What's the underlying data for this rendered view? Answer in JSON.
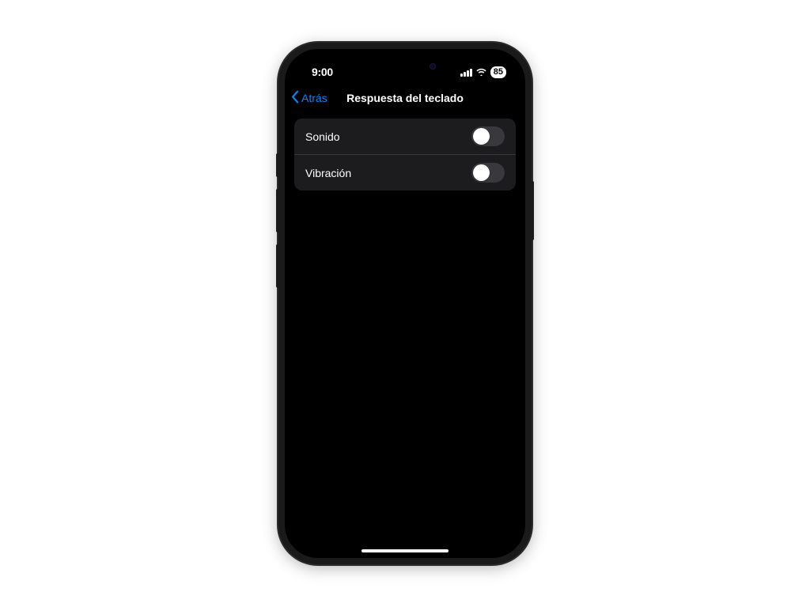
{
  "status_bar": {
    "time": "9:00",
    "battery_percent": "85"
  },
  "nav": {
    "back_label": "Atrás",
    "title": "Respuesta del teclado"
  },
  "settings": {
    "rows": [
      {
        "label": "Sonido",
        "on": false
      },
      {
        "label": "Vibración",
        "on": false
      }
    ]
  }
}
